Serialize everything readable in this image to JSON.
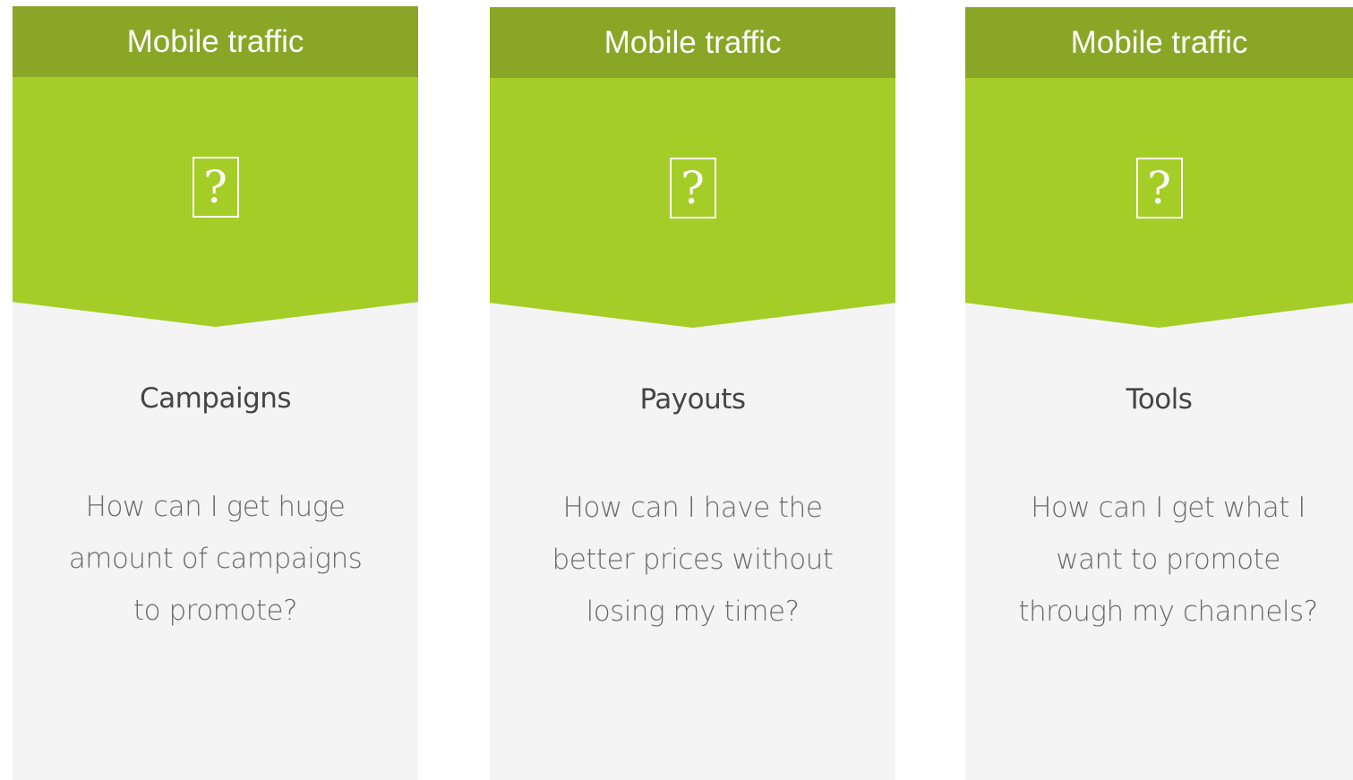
{
  "cards": [
    {
      "header": "Mobile traffic",
      "icon": "question-mark-box",
      "title": "Campaigns",
      "text": "How can I get huge amount of campaigns to promote?"
    },
    {
      "header": "Mobile traffic",
      "icon": "question-mark-box",
      "title": "Payouts",
      "text": "How can I have the better prices without losing my time?"
    },
    {
      "header": "Mobile traffic",
      "icon": "question-mark-box",
      "title": "Tools",
      "text": "How can I get what I want to promote through my channels?"
    }
  ],
  "colors": {
    "header_bg": "#89a626",
    "banner_bg": "#a4cd27",
    "card_bg": "#f4f4f4",
    "title_text": "#454545",
    "body_text": "#6a6a6a"
  }
}
